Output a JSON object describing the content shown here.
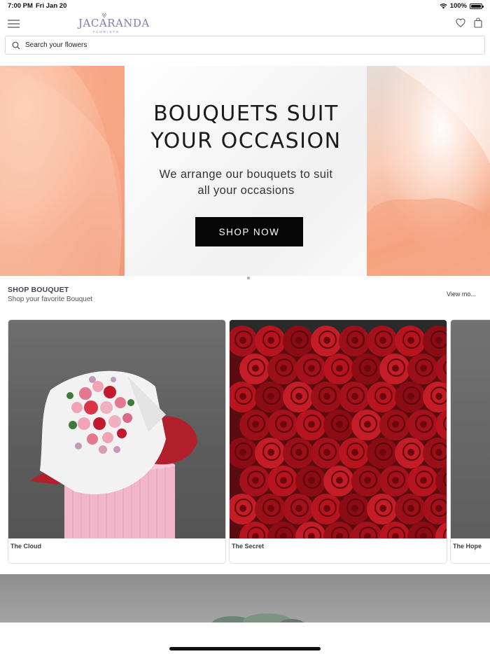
{
  "status_bar": {
    "time": "7:00 PM",
    "date": "Fri Jan 20",
    "battery": "100%"
  },
  "header": {
    "logo_text": "JACARANDA",
    "logo_subtext": "FLORISTS",
    "icons": [
      "menu-icon",
      "heart-icon",
      "bag-icon"
    ]
  },
  "search": {
    "placeholder": "Search your flowers"
  },
  "hero": {
    "title_line1": "BOUQUETS SUIT",
    "title_line2": "YOUR OCCASION",
    "subtitle_line1": "We arrange our bouquets to suit",
    "subtitle_line2": "all your occasions",
    "cta": "SHOP NOW"
  },
  "section": {
    "title": "SHOP BOUQUET",
    "subtitle": "Shop your favorite Bouquet",
    "view_more": "View mo..."
  },
  "products": [
    {
      "name": "The Cloud"
    },
    {
      "name": "The Secret"
    },
    {
      "name": "The Hope"
    }
  ],
  "colors": {
    "brand_lavender": "#8a76b4",
    "cta_background": "#050505",
    "hero_peach": "#f8b296",
    "section_title": "#3f4652"
  }
}
